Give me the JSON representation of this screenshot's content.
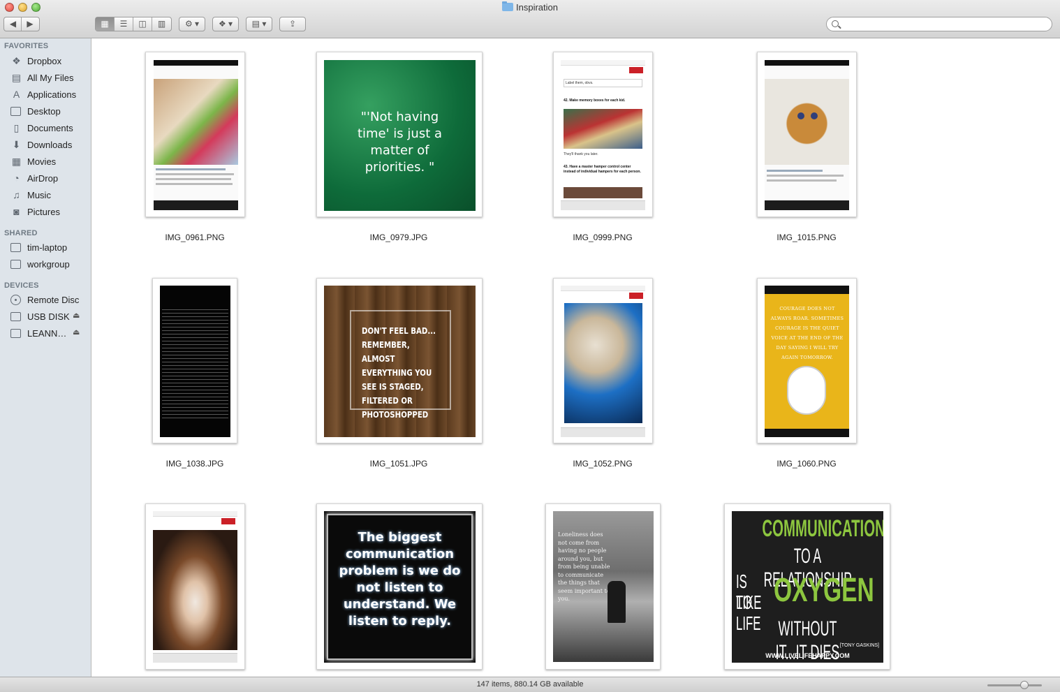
{
  "window": {
    "title": "Inspiration"
  },
  "toolbar": {
    "back_icon": "chevron-left-icon",
    "forward_icon": "chevron-right-icon",
    "view_modes": [
      "icon-view",
      "list-view",
      "column-view",
      "cover-flow-view"
    ],
    "active_view": "icon-view",
    "action_icon": "gear-icon",
    "dropbox_icon": "dropbox-icon",
    "arrange_icon": "arrange-icon",
    "share_icon": "share-icon",
    "search_placeholder": ""
  },
  "sidebar": {
    "favorites_header": "FAVORITES",
    "favorites": [
      {
        "label": "Dropbox",
        "icon": "dropbox-icon"
      },
      {
        "label": "All My Files",
        "icon": "all-files-icon"
      },
      {
        "label": "Applications",
        "icon": "applications-icon"
      },
      {
        "label": "Desktop",
        "icon": "desktop-icon"
      },
      {
        "label": "Documents",
        "icon": "documents-icon"
      },
      {
        "label": "Downloads",
        "icon": "downloads-icon"
      },
      {
        "label": "Movies",
        "icon": "movies-icon"
      },
      {
        "label": "AirDrop",
        "icon": "airdrop-icon"
      },
      {
        "label": "Music",
        "icon": "music-icon"
      },
      {
        "label": "Pictures",
        "icon": "pictures-icon"
      }
    ],
    "shared_header": "SHARED",
    "shared": [
      {
        "label": "tim-laptop",
        "icon": "computer-icon"
      },
      {
        "label": "workgroup",
        "icon": "computer-icon"
      }
    ],
    "devices_header": "DEVICES",
    "devices": [
      {
        "label": "Remote Disc",
        "icon": "remote-disc-icon"
      },
      {
        "label": "USB DISK",
        "icon": "drive-icon",
        "eject": true
      },
      {
        "label": "LEANN…",
        "icon": "drive-icon",
        "eject": true
      }
    ]
  },
  "files": [
    {
      "name": "IMG_0961.PNG",
      "kind": "instagram-screenshot"
    },
    {
      "name": "IMG_0979.JPG",
      "kind": "quote-green",
      "quote": "\"'Not having time' is just a matter of priorities. \""
    },
    {
      "name": "IMG_0999.PNG",
      "kind": "buzzfeed-screenshot",
      "lines": [
        "Label them, obvs.",
        "42. Make memory boxes for each kid.",
        "They'll thank you later.",
        "43. Have a master hamper control center instead of individual hampers for each person."
      ]
    },
    {
      "name": "IMG_1015.PNG",
      "kind": "instagram-screenshot-bear"
    },
    {
      "name": "IMG_1038.JPG",
      "kind": "text-black"
    },
    {
      "name": "IMG_1051.JPG",
      "kind": "quote-wood",
      "quote": "DON'T FEEL BAD... REMEMBER, ALMOST EVERYTHING YOU SEE IS STAGED, FILTERED OR PHOTOSHOPPED"
    },
    {
      "name": "IMG_1052.PNG",
      "kind": "pinterest-screenshot-drinks"
    },
    {
      "name": "IMG_1060.PNG",
      "kind": "quote-yellow-lion",
      "quote": "Courage does not always roar. Sometimes courage is the quiet voice at the end of the day saying I will try again tomorrow."
    },
    {
      "name": "",
      "kind": "pinterest-screenshot-woman"
    },
    {
      "name": "",
      "kind": "quote-black",
      "quote": "The biggest communication problem is we do not listen to understand. We listen to reply."
    },
    {
      "name": "",
      "kind": "quote-bw-photo",
      "quote": "Loneliness does not come from having no people around you, but from being unable to communicate the things that seem important to you."
    },
    {
      "name": "",
      "kind": "quote-oxygen",
      "quote_lines": [
        "COMMUNICATION",
        "TO A RELATIONSHIP",
        "IS LIKE",
        "OXYGEN",
        "TO LIFE",
        "WITHOUT IT...IT DIES"
      ],
      "attribution": "[TONY GASKINS]",
      "url": "WWW.LIVELIFEHAPPY.COM"
    }
  ],
  "status": {
    "text": "147 items, 880.14 GB available"
  }
}
